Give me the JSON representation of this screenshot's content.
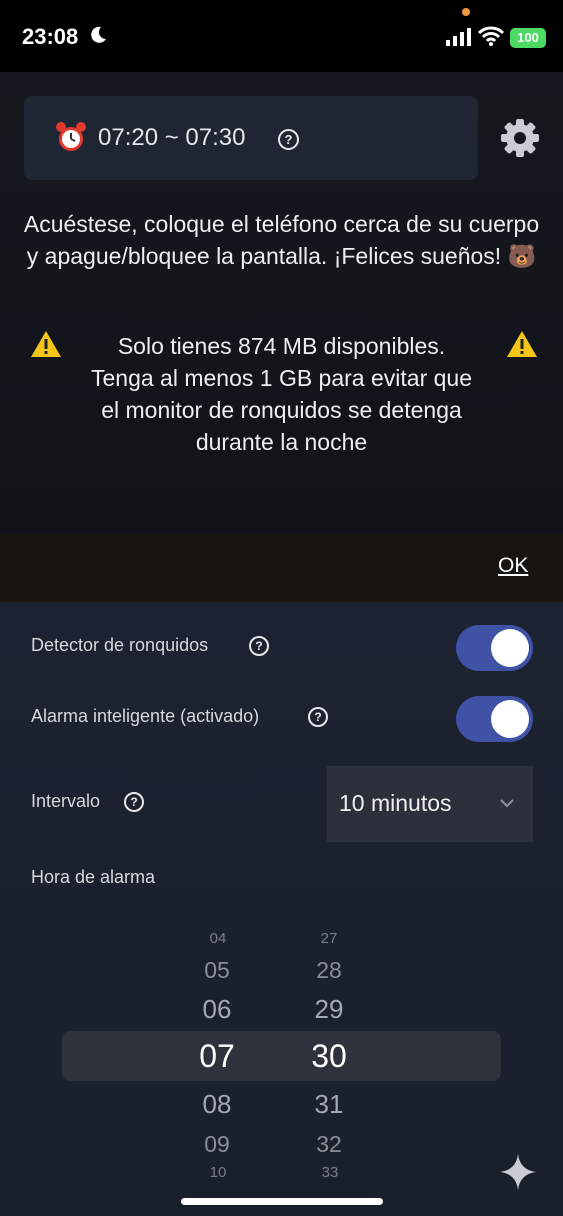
{
  "status_bar": {
    "time": "23:08",
    "battery": "100"
  },
  "alarm": {
    "range": "07:20 ~ 07:30"
  },
  "instructions": "Acuéstese, coloque el teléfono cerca de su cuerpo y apague/bloquee la pantalla. ¡Felices sueños! 🐻",
  "warning": {
    "line1": "Solo tienes 874 MB disponibles.",
    "line2": "Tenga al menos 1 GB para evitar que",
    "line3": "el monitor de ronquidos se detenga",
    "line4": "durante la noche"
  },
  "ok_label": "OK",
  "settings": {
    "snore_detector_label": "Detector de ronquidos",
    "smart_alarm_label": "Alarma inteligente (activado)",
    "interval_label": "Intervalo",
    "interval_value": "10 minutos",
    "alarm_time_label": "Hora de alarma"
  },
  "picker": {
    "hours": [
      "04",
      "05",
      "06",
      "07",
      "08",
      "09",
      "10"
    ],
    "minutes": [
      "27",
      "28",
      "29",
      "30",
      "31",
      "32",
      "33"
    ],
    "selected_hour": "07",
    "selected_minute": "30"
  },
  "colors": {
    "toggle_on": "#3f52a6",
    "warning": "#f5c518",
    "background": "#0d0f14"
  },
  "icons": [
    "moon-icon",
    "signal-icon",
    "wifi-icon",
    "alarm-clock-icon",
    "help-icon",
    "gear-icon",
    "warning-icon",
    "chevron-down-icon",
    "sparkle-icon"
  ]
}
